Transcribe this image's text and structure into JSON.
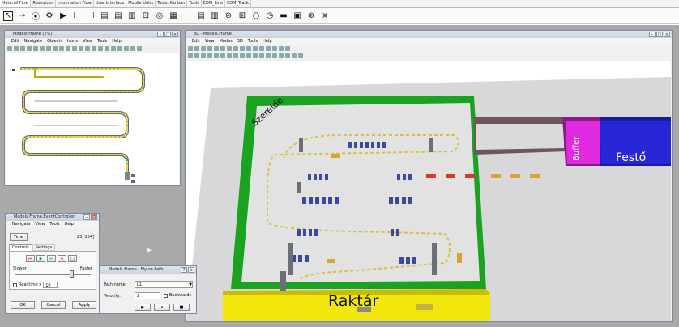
{
  "tabs": [
    "Material Flow",
    "Resources",
    "Information Flow",
    "User Interface",
    "Mobile Units",
    "Tools: Kanban",
    "Tools",
    "EOM_Line",
    "EOM_Track"
  ],
  "toolbar_icons": [
    "cursor-icon",
    "connector-icon",
    "source-icon",
    "gear-icon",
    "play-icon",
    "buffer-icon",
    "store-icon",
    "line-icon",
    "line-icon",
    "track-icon",
    "station-icon",
    "cycle-icon",
    "table-icon",
    "store-icon",
    "line-icon",
    "track-icon",
    "turntable-icon",
    "sorter-icon",
    "circle-icon",
    "clock-icon",
    "drain-icon",
    "frame-icon",
    "globe-icon",
    "assembly-icon"
  ],
  "tree": {
    "title": "Models.Frame (2%)",
    "menu": [
      "Edit",
      "Navigate",
      "Objects",
      "Icons",
      "View",
      "Tools",
      "Help"
    ]
  },
  "view3d": {
    "title": "3D - Models.Frame",
    "menu": [
      "Edit",
      "View",
      "Modes",
      "3D",
      "Tools",
      "Help"
    ],
    "labels": {
      "szerelde": "Szerelde",
      "buffer": "Buffer",
      "festo": "Festő",
      "raktar": "Raktár"
    }
  },
  "event": {
    "title": "Models.Frame.EventController",
    "menu": [
      "Navigate",
      "View",
      "Tools",
      "Help"
    ],
    "time_label": "Time",
    "time_value": "23, 154]",
    "tabs": [
      "Controls",
      "Settings"
    ],
    "slower": "Slower",
    "faster": "Faster",
    "realtime": "Real time x",
    "realtime_value": "10",
    "ok": "OK",
    "cancel": "Cancel",
    "apply": "Apply"
  },
  "fly": {
    "title": "Models.Frame - Fly on Path",
    "path_label": "Path name:",
    "path_value": "L1",
    "velocity_label": "Velocity:",
    "velocity_value": "2",
    "backwards": "Backwards"
  },
  "colors": {
    "green": "#12a01a",
    "yellow": "#f2e60a",
    "magenta": "#e02ae0",
    "blue": "#2323d8",
    "floor": "#d6d6d6"
  }
}
